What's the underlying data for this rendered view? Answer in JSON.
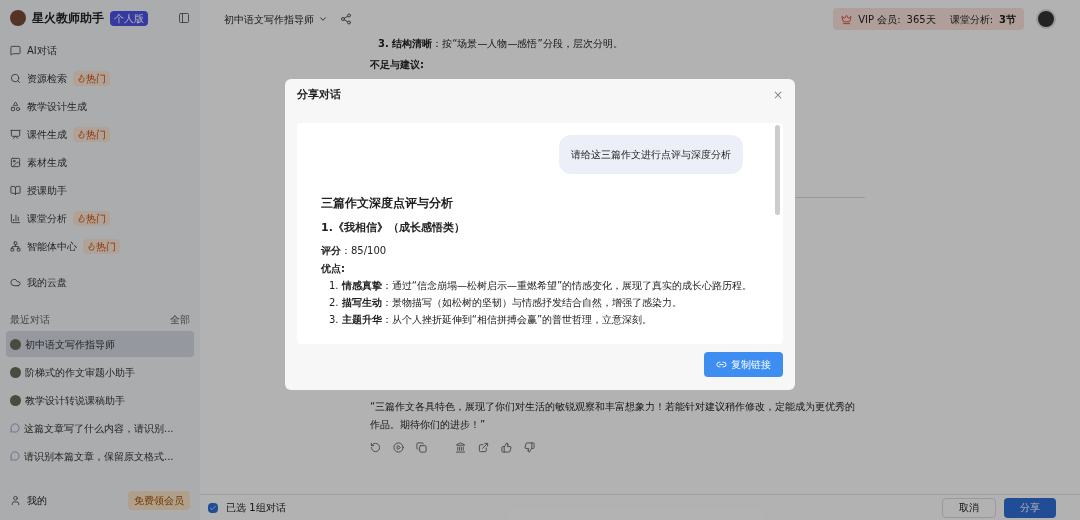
{
  "sidebar": {
    "brand": "星火教师助手",
    "edition_badge": "个人版",
    "nav_items": [
      {
        "label": "AI对话"
      },
      {
        "label": "资源检索",
        "badge": "热门"
      },
      {
        "label": "教学设计生成"
      },
      {
        "label": "课件生成",
        "badge": "热门"
      },
      {
        "label": "素材生成"
      },
      {
        "label": "授课助手"
      },
      {
        "label": "课堂分析",
        "badge": "热门"
      },
      {
        "label": "智能体中心",
        "badge": "热门"
      },
      {
        "label": "我的云盘"
      }
    ],
    "recent_title": "最近对话",
    "recent_all": "全部",
    "recent_items": [
      {
        "label": "初中语文写作指导师",
        "kind": "agent",
        "selected": true
      },
      {
        "label": "阶梯式的作文审题小助手",
        "kind": "agent",
        "selected": false
      },
      {
        "label": "教学设计转说课稿助手",
        "kind": "agent",
        "selected": false
      },
      {
        "label": "这篇文章写了什么内容，请识别...",
        "kind": "chat",
        "selected": false
      },
      {
        "label": "请识别本篇文章，保留原文格式...",
        "kind": "chat",
        "selected": false
      }
    ],
    "user_label": "我的",
    "member_button": "免费领会员"
  },
  "header": {
    "title": "初中语文写作指导师",
    "vip_label": "VIP 会员:",
    "vip_days": "365天",
    "analysis_label": "课堂分析:",
    "analysis_count": "3节"
  },
  "conversation": {
    "top_lines": [
      {
        "lead": "3. 结构清晰",
        "text": "：按“场景—人物—感悟”分段，层次分明。"
      }
    ],
    "subheading": "不足与建议:",
    "closing": "“三篇作文各具特色，展现了你们对生活的敏锐观察和丰富想象力！若能针对建议稍作修改，定能成为更优秀的作品。期待你们的进步！”"
  },
  "selection_bar": {
    "checked": true,
    "label": "已选 1组对话",
    "cancel": "取消",
    "share": "分享"
  },
  "dialog": {
    "title": "分享对话",
    "close": "×",
    "user_message": "请给这三篇作文进行点评与深度分析",
    "heading": "三篇作文深度点评与分析",
    "subheading": "1.《我相信》（成长感悟类）",
    "score": "**评分**：85/100",
    "strengths_title": "优点:",
    "strengths": [
      {
        "number": "1.",
        "lead": "情感真挚",
        "text": "：通过“信念崩塌—松树启示—重燃希望”的情感变化，展现了真实的成长心路历程。"
      },
      {
        "number": "2.",
        "lead": "描写生动",
        "text": "：景物描写（如松树的坚韧）与情感抒发结合自然，增强了感染力。"
      },
      {
        "number": "3.",
        "lead": "主题升华",
        "text": "：从个人挫折延伸到“相信拼搏会赢”的普世哲理，立意深刻。"
      }
    ],
    "copy_button": "复制链接"
  }
}
